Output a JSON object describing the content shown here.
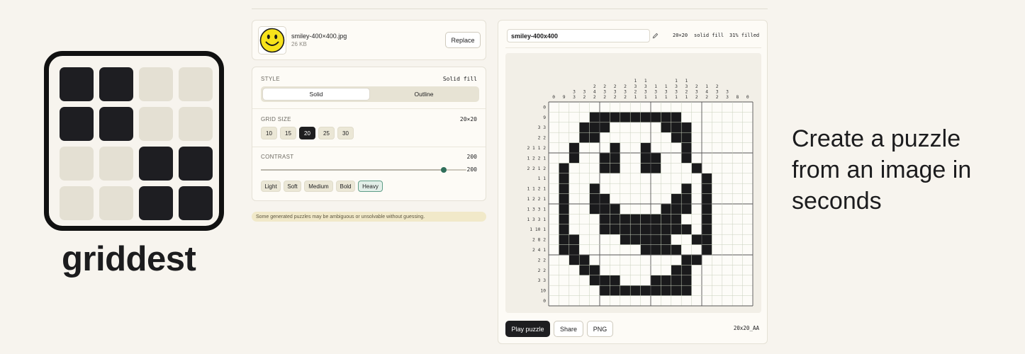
{
  "brand": {
    "name": "griddest",
    "logo_pattern": [
      [
        1,
        1,
        0,
        0
      ],
      [
        1,
        1,
        0,
        0
      ],
      [
        0,
        0,
        1,
        1
      ],
      [
        0,
        0,
        1,
        1
      ]
    ],
    "colors": {
      "dark": "#1e1e22",
      "light": "#e4e0d3",
      "accent": "#2f6e5a"
    }
  },
  "tagline": "Create a puzzle from an image in seconds",
  "file": {
    "thumbnail_icon": "smiley-face-icon",
    "name": "smiley-400×400.jpg",
    "size": "26 KB",
    "replace_label": "Replace"
  },
  "style": {
    "label": "STYLE",
    "value": "Solid fill",
    "options": [
      "Solid",
      "Outline"
    ],
    "selected": "Solid"
  },
  "grid_size": {
    "label": "GRID SIZE",
    "value": "20×20",
    "options": [
      "10",
      "15",
      "20",
      "25",
      "30"
    ],
    "selected": "20"
  },
  "contrast": {
    "label": "CONTRAST",
    "value": "200",
    "slider_value": "200",
    "slider_fraction": 0.89,
    "presets": [
      "Light",
      "Soft",
      "Medium",
      "Bold",
      "Heavy"
    ],
    "selected": "Heavy"
  },
  "notice": "Some generated puzzles may be ambiguous or unsolvable without guessing.",
  "puzzle": {
    "title": "smiley-400x400",
    "size_tag": "20×20",
    "fill_tag": "solid fill",
    "filled_tag": "31% filled",
    "col_clues": [
      [
        "0"
      ],
      [
        "9"
      ],
      [
        "3",
        "3"
      ],
      [
        "3",
        "2"
      ],
      [
        "2",
        "4",
        "2"
      ],
      [
        "2",
        "3",
        "2"
      ],
      [
        "2",
        "3",
        "2"
      ],
      [
        "2",
        "3",
        "2"
      ],
      [
        "1",
        "3",
        "2",
        "1"
      ],
      [
        "1",
        "3",
        "3",
        "1"
      ],
      [
        "1",
        "3",
        "1"
      ],
      [
        "1",
        "3",
        "1"
      ],
      [
        "1",
        "3",
        "3",
        "1"
      ],
      [
        "1",
        "3",
        "2",
        "1"
      ],
      [
        "2",
        "3",
        "2"
      ],
      [
        "1",
        "4",
        "2"
      ],
      [
        "2",
        "3",
        "2"
      ],
      [
        "3",
        "3"
      ],
      [
        "8"
      ],
      [
        "0"
      ]
    ],
    "row_clues": [
      "0",
      "9",
      "3 3",
      "2 2",
      "2 1 1 2",
      "1 2 2 1",
      "2 2 1 2",
      "1 1",
      "1 1 2 1",
      "1 2 2 1",
      "1 3 3 1",
      "1 3 3 1",
      "1 10 1",
      "2 8 2",
      "2 4 1",
      "2 2",
      "2 2",
      "3 3",
      "10",
      "0"
    ],
    "grid": [
      "....................",
      "....XXXXXXXXX.......",
      "...XXX.....XXX......",
      "...XX.......XX......",
      "..X...X..X...X......",
      "..X..XX..XX..X......",
      ".X...XX..XX...X.....",
      ".X.............X....",
      ".X..X........X.X....",
      ".X..XX......XX.X....",
      ".X..XXX....XXX.X....",
      ".X...XXXXXXXX..X....",
      ".X...XXXXXXXXX.X....",
      ".XX....XXXXX..XX....",
      ".XX......XXXX..X....",
      "..XX.........XX.....",
      "...XX.......XX......",
      "....XXX...XXXX......",
      ".....XXXXXXXXX......",
      "...................."
    ],
    "actions": [
      "Play puzzle",
      "Share",
      "PNG"
    ],
    "code": "20x20_AA"
  }
}
